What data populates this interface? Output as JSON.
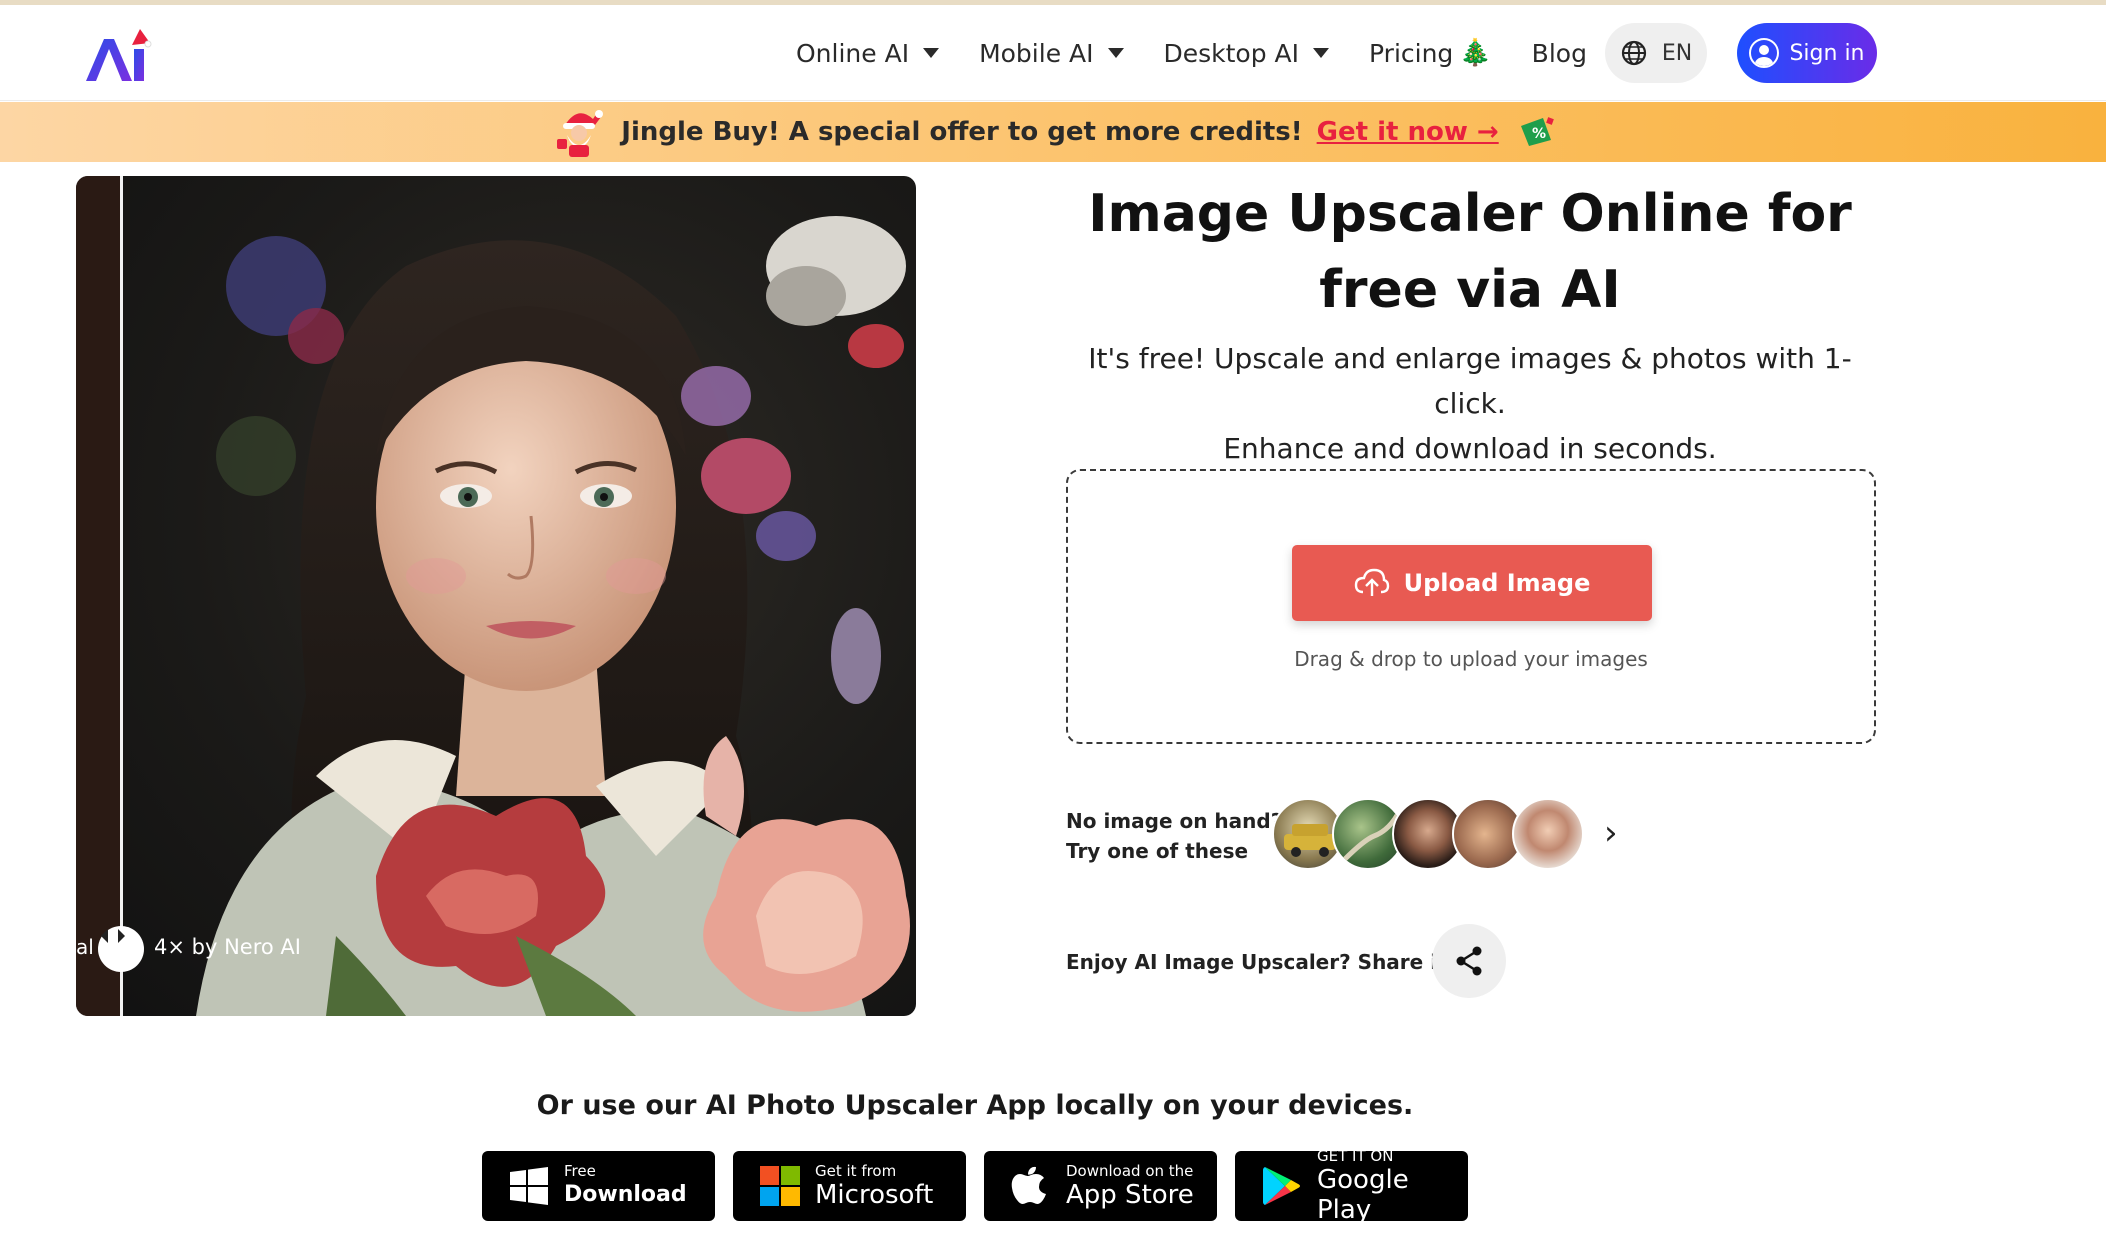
{
  "header": {
    "nav": [
      {
        "label": "Online AI",
        "has_dropdown": true
      },
      {
        "label": "Mobile AI",
        "has_dropdown": true
      },
      {
        "label": "Desktop AI",
        "has_dropdown": true
      },
      {
        "label": "Pricing",
        "has_dropdown": false,
        "icon": "christmas-tree-icon"
      },
      {
        "label": "Blog",
        "has_dropdown": false
      }
    ],
    "language": "EN",
    "sign_in": "Sign in"
  },
  "promo": {
    "text": "Jingle Buy! A special offer to get more credits!",
    "link": "Get it now →"
  },
  "hero": {
    "label_left": "al",
    "label_right": "4× by Nero AI"
  },
  "main": {
    "title": "Image Upscaler Online for free via AI",
    "subtitle_line1": "It's free! Upscale and enlarge images & photos with 1-click.",
    "subtitle_line2": "Enhance and download in seconds.",
    "upload_button": "Upload Image",
    "drop_hint": "Drag & drop to upload your images",
    "samples_line1": "No image on hand?",
    "samples_line2": "Try one of these",
    "share_text": "Enjoy AI Image Upscaler? Share it!"
  },
  "devices": {
    "heading": "Or use our AI Photo Upscaler App locally on your devices.",
    "stores": [
      {
        "small": "Free",
        "big": "Download",
        "icon": "windows-icon"
      },
      {
        "small": "Get it from",
        "big": "Microsoft",
        "icon": "microsoft-icon"
      },
      {
        "small": "Download on the",
        "big": "App Store",
        "icon": "apple-icon"
      },
      {
        "small": "GET IT ON",
        "big": "Google Play",
        "icon": "google-play-icon"
      }
    ]
  },
  "colors": {
    "accent_gradient_start": "#1e4fff",
    "accent_gradient_end": "#6a2ce8",
    "upload_button": "#e85a52",
    "promo_link": "#e8213f"
  }
}
